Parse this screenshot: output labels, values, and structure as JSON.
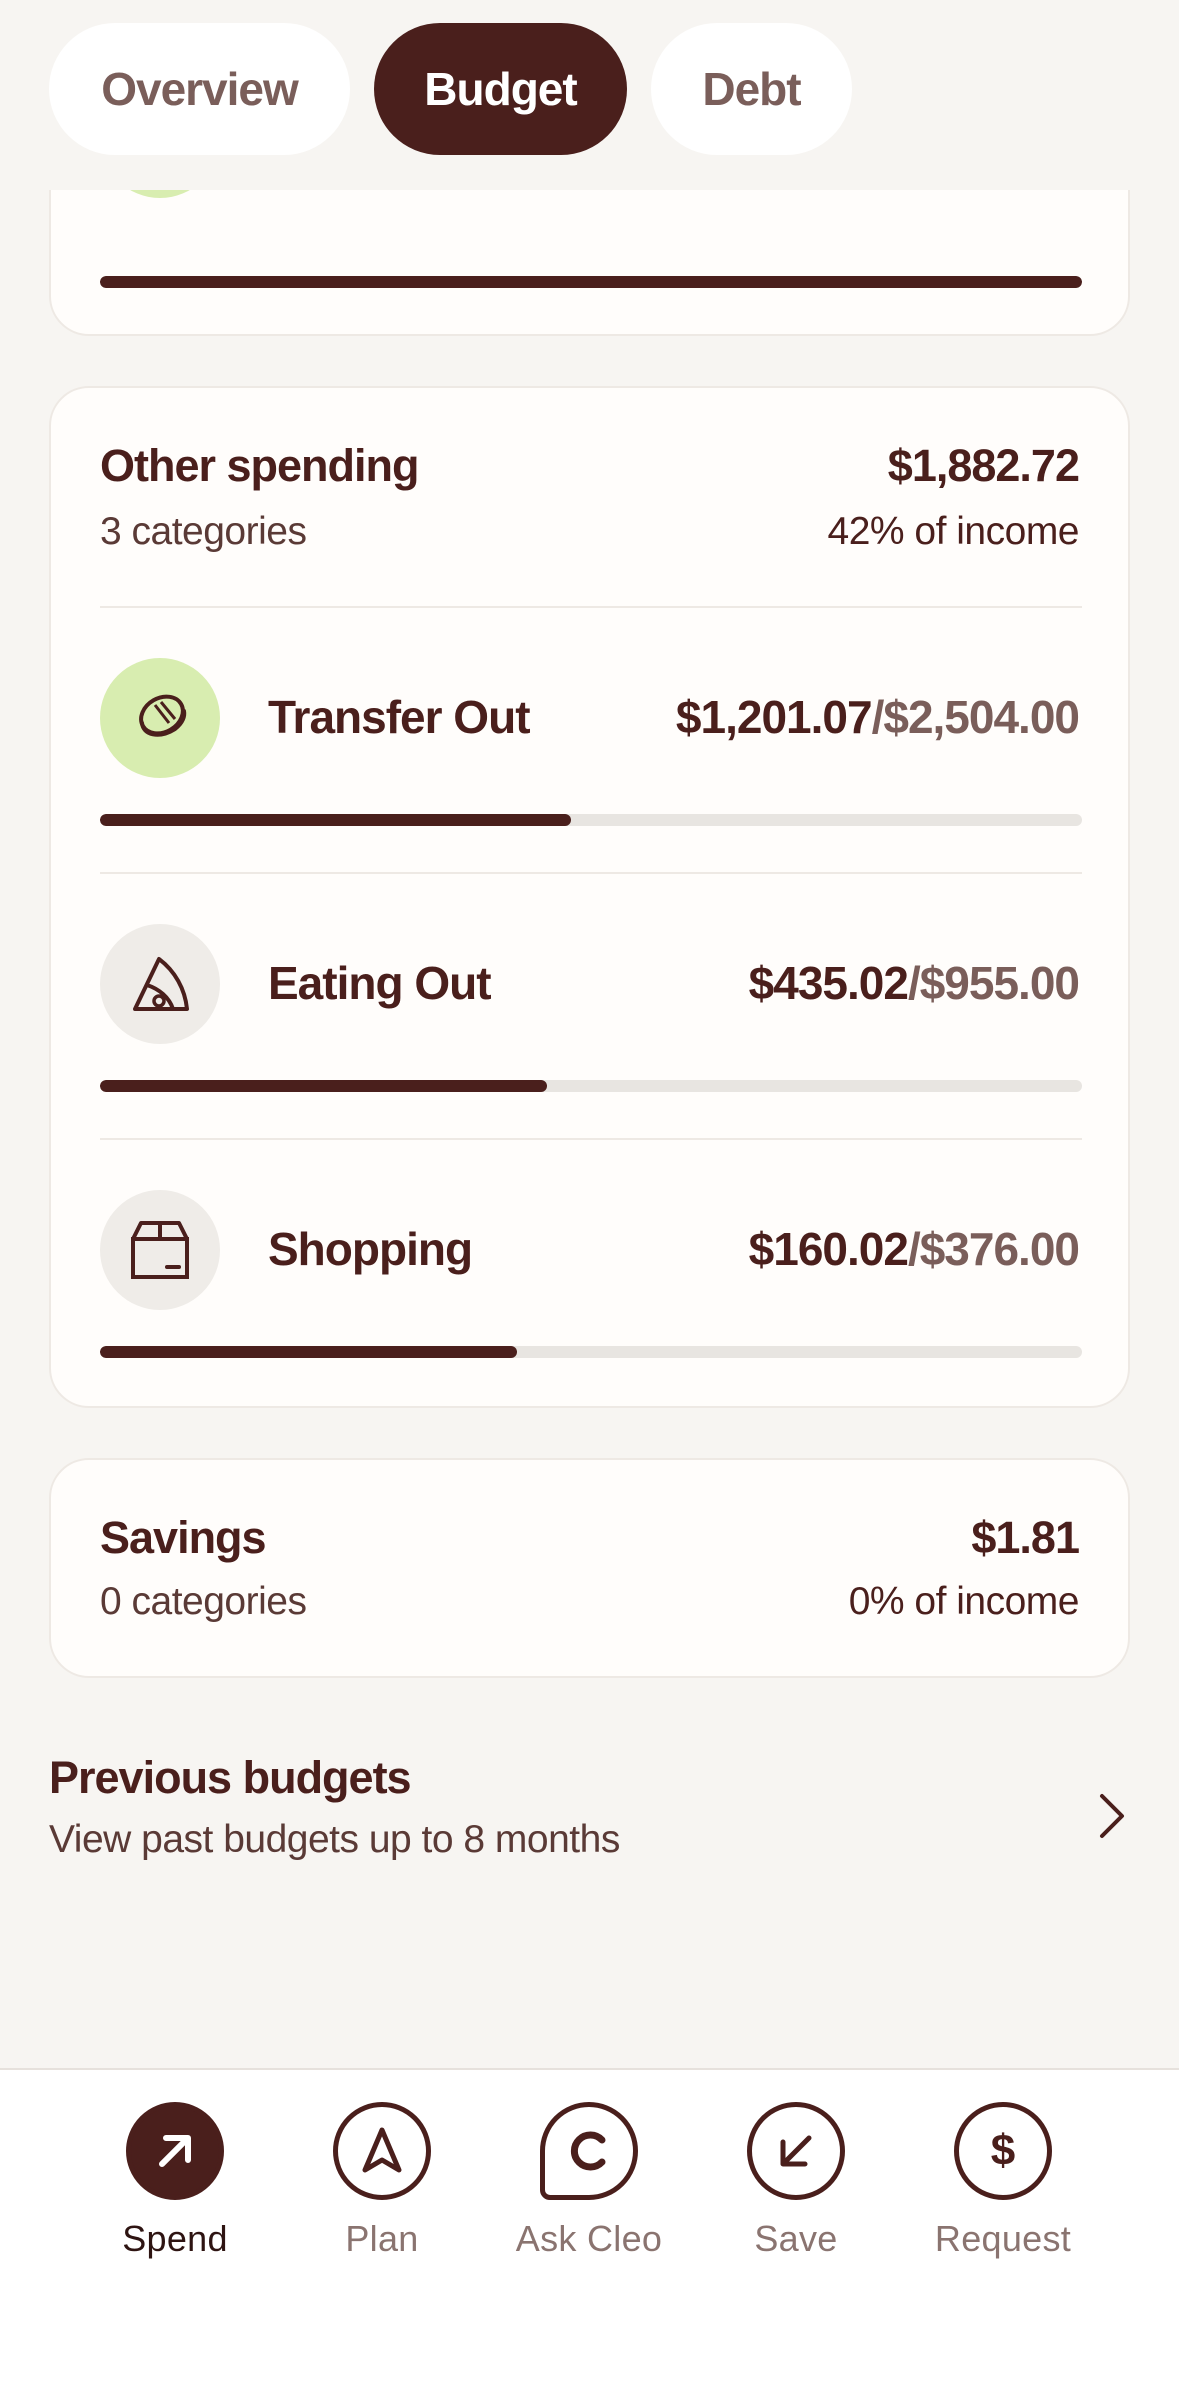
{
  "tabs": [
    {
      "label": "Overview",
      "active": false
    },
    {
      "label": "Budget",
      "active": true
    },
    {
      "label": "Debt",
      "active": false
    }
  ],
  "loans_card": {
    "progress": 1.0
  },
  "other_spending": {
    "title": "Other spending",
    "subtitle": "3 categories",
    "amount": "$1,882.72",
    "percent": "42% of income",
    "categories": [
      {
        "name": "Transfer Out",
        "spent": "$1,201.07",
        "limit": "/$2,504.00",
        "icon": "coin-icon",
        "icon_bg": "#D8EDB0",
        "progress": 0.48
      },
      {
        "name": "Eating Out",
        "spent": "$435.02",
        "limit": "/$955.00",
        "icon": "pizza-slice-icon",
        "icon_bg": "#EFECE8",
        "progress": 0.455
      },
      {
        "name": "Shopping",
        "spent": "$160.02",
        "limit": "/$376.00",
        "icon": "box-icon",
        "icon_bg": "#EFECE8",
        "progress": 0.425
      }
    ]
  },
  "savings": {
    "title": "Savings",
    "subtitle": "0 categories",
    "amount": "$1.81",
    "percent": "0% of income"
  },
  "previous_budgets": {
    "title": "Previous budgets",
    "subtitle": "View past budgets up to 8 months"
  },
  "bottom_nav": [
    {
      "label": "Spend",
      "icon": "arrow-up-right-icon",
      "active": true
    },
    {
      "label": "Plan",
      "icon": "navigation-arrow-icon",
      "active": false
    },
    {
      "label": "Ask Cleo",
      "icon": "cleo-chat-icon",
      "active": false
    },
    {
      "label": "Save",
      "icon": "arrow-down-left-icon",
      "active": false
    },
    {
      "label": "Request",
      "icon": "dollar-icon",
      "active": false
    }
  ],
  "colors": {
    "brand": "#4A1F1C",
    "accent_green": "#D8EDB0",
    "background": "#F7F5F2"
  }
}
